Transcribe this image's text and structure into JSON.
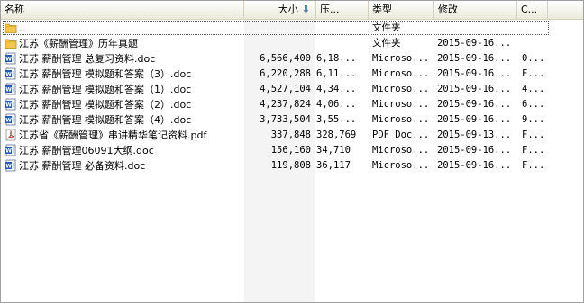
{
  "columns": {
    "name": "名称",
    "size": "大小",
    "compressed": "压...",
    "type": "类型",
    "modified": "修改",
    "crc": "C..."
  },
  "rows": [
    {
      "icon": "folder-icon",
      "name": "..",
      "size": "",
      "compressed": "",
      "type": "文件夹",
      "modified": "",
      "crc": ""
    },
    {
      "icon": "folder-icon",
      "name": "江苏《薪酬管理》历年真题",
      "size": "",
      "compressed": "",
      "type": "文件夹",
      "modified": "2015-09-16...",
      "crc": ""
    },
    {
      "icon": "word-doc-icon",
      "name": "江苏 薪酬管理 总复习资料.doc",
      "size": "6,566,400",
      "compressed": "6,18...",
      "type": "Microso...",
      "modified": "2015-09-16...",
      "crc": "0..."
    },
    {
      "icon": "word-doc-icon",
      "name": "江苏 薪酬管理 模拟题和答案（3）.doc",
      "size": "6,220,288",
      "compressed": "6,11...",
      "type": "Microso...",
      "modified": "2015-09-16...",
      "crc": "F..."
    },
    {
      "icon": "word-doc-icon",
      "name": "江苏 薪酬管理 模拟题和答案（1）.doc",
      "size": "4,527,104",
      "compressed": "4,34...",
      "type": "Microso...",
      "modified": "2015-09-16...",
      "crc": "4..."
    },
    {
      "icon": "word-doc-icon",
      "name": "江苏 薪酬管理 模拟题和答案（2）.doc",
      "size": "4,237,824",
      "compressed": "4,06...",
      "type": "Microso...",
      "modified": "2015-09-16...",
      "crc": "6..."
    },
    {
      "icon": "word-doc-icon",
      "name": "江苏 薪酬管理 模拟题和答案（4）.doc",
      "size": "3,733,504",
      "compressed": "3,55...",
      "type": "Microso...",
      "modified": "2015-09-16...",
      "crc": "9..."
    },
    {
      "icon": "pdf-icon",
      "name": "江苏省《薪酬管理》串讲精华笔记资料.pdf",
      "size": "337,848",
      "compressed": "328,769",
      "type": "PDF Doc...",
      "modified": "2015-09-13...",
      "crc": "F..."
    },
    {
      "icon": "word-doc-icon",
      "name": "江苏 薪酬管理06091大纲.doc",
      "size": "156,160",
      "compressed": "34,710",
      "type": "Microso...",
      "modified": "2015-09-16...",
      "crc": "F..."
    },
    {
      "icon": "word-doc-icon",
      "name": "江苏 薪酬管理 必备资料.doc",
      "size": "119,808",
      "compressed": "36,117",
      "type": "Microso...",
      "modified": "2015-09-16...",
      "crc": "F..."
    }
  ],
  "colors": {
    "folder": "#f4c64a",
    "word": "#2a5bb7",
    "pdf": "#c8402e",
    "sort_arrow": "#2f5ea8"
  }
}
